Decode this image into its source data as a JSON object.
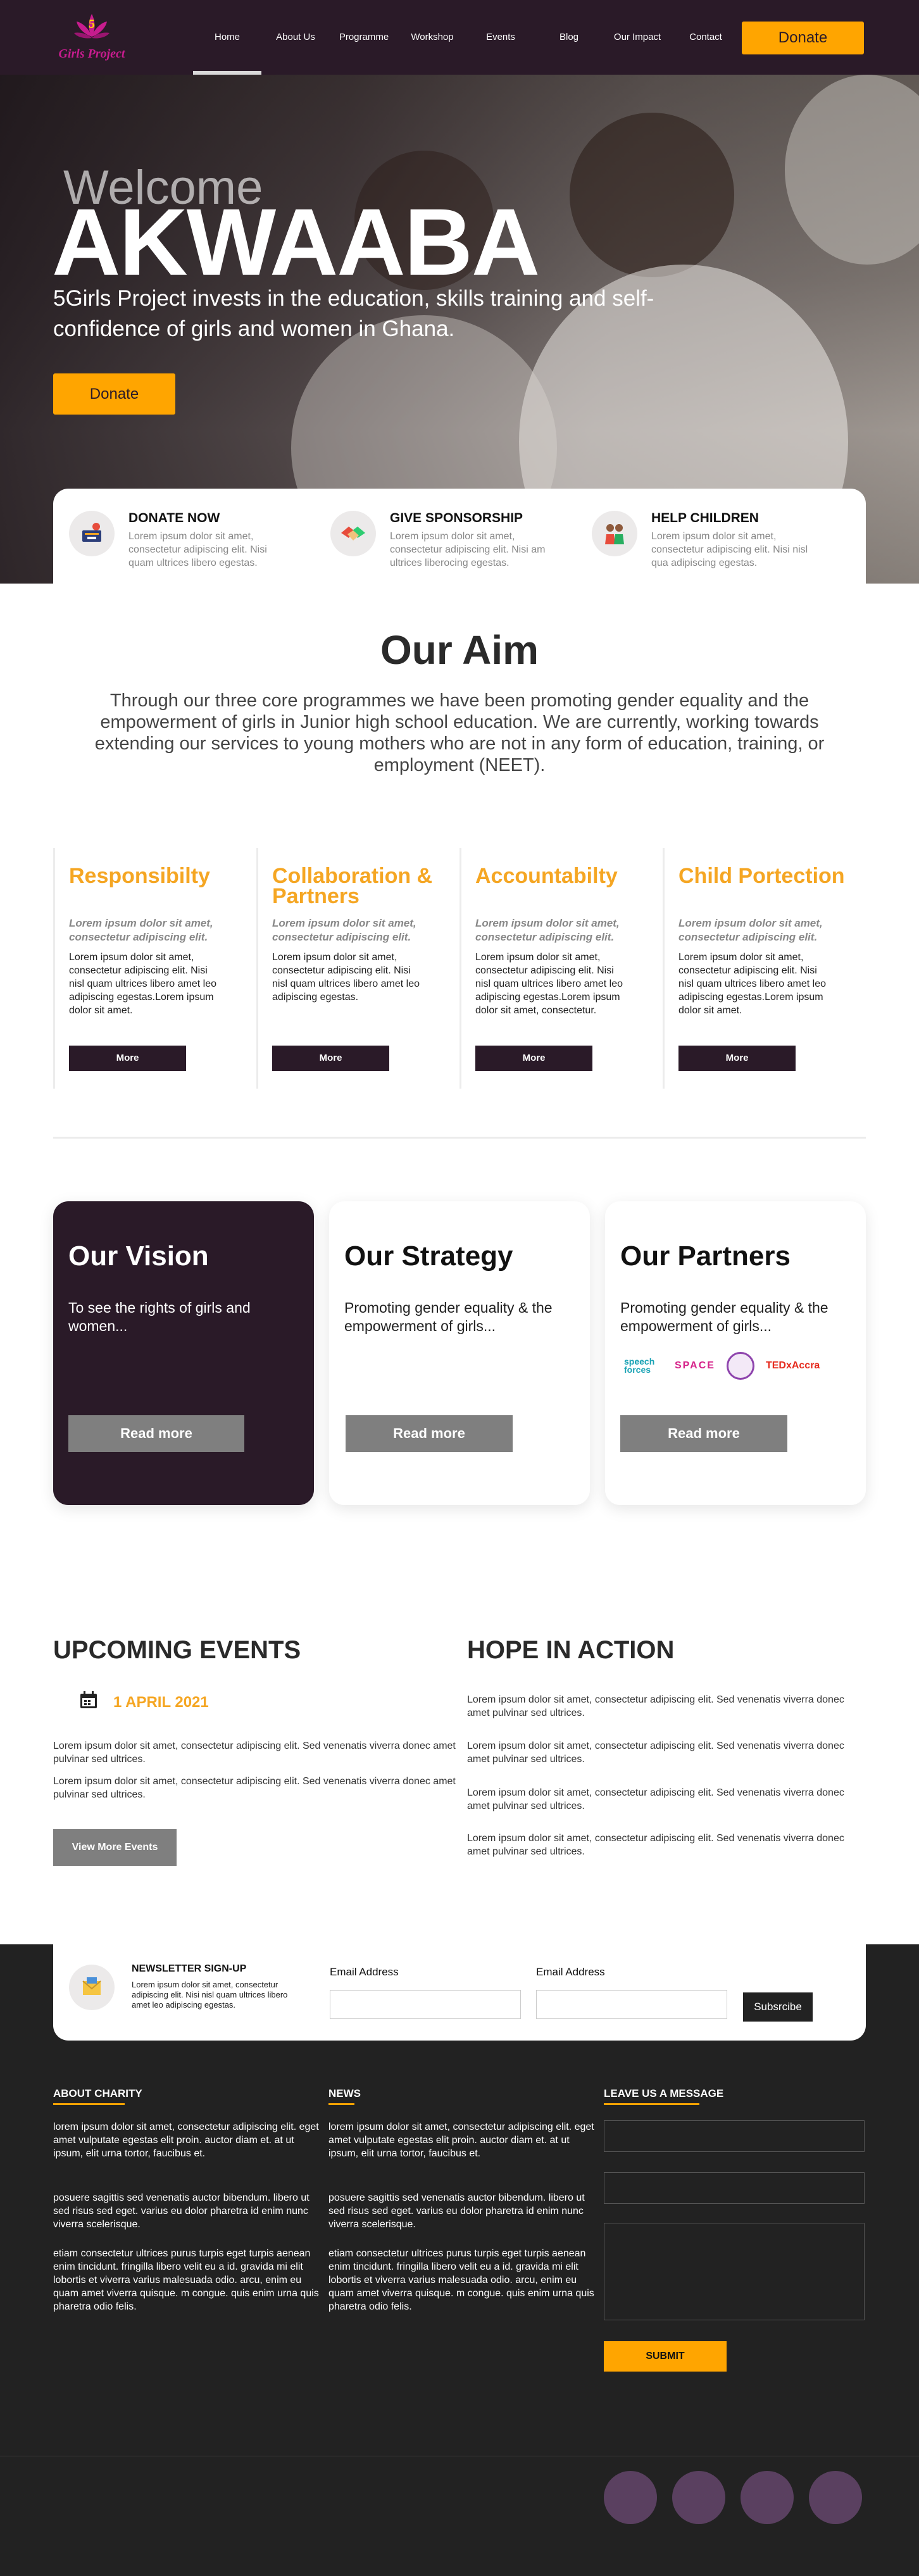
{
  "nav": {
    "logo_text": "Girls Project",
    "links": [
      "Home",
      "About Us",
      "Programme",
      "Workshop",
      "Events",
      "Blog",
      "Our Impact",
      "Contact"
    ],
    "donate_label": "Donate"
  },
  "hero": {
    "welcome": "Welcome",
    "title": "AKWAABA",
    "subtitle": "5Girls Project invests in the education, skills training and self-confidence of girls and women in Ghana.",
    "donate_label": "Donate"
  },
  "services": [
    {
      "title": "DONATE NOW",
      "text": "Lorem ipsum dolor sit amet, consectetur adipiscing elit. Nisi quam ultrices libero egestas.",
      "icon": "donate-icon"
    },
    {
      "title": "GIVE SPONSORSHIP",
      "text": "Lorem ipsum dolor sit amet, consectetur adipiscing elit. Nisi am ultrices liberocing egestas.",
      "icon": "handshake-icon"
    },
    {
      "title": "HELP CHILDREN",
      "text": "Lorem ipsum dolor sit amet, consectetur adipiscing elit. Nisi nisl qua adipiscing egestas.",
      "icon": "children-icon"
    }
  ],
  "aim": {
    "title": "Our Aim",
    "text": "Through our three core programmes we have been promoting gender equality and the empowerment of girls in Junior high school education. We are currently, working towards extending our services to young mothers who are not in any form of education, training, or employment (NEET)."
  },
  "values": [
    {
      "title": "Responsibilty",
      "lead": "Lorem ipsum dolor sit amet, consectetur adipiscing elit.",
      "body": "Lorem ipsum dolor sit amet, consectetur adipiscing elit. Nisi nisl quam ultrices libero amet leo adipiscing egestas.Lorem ipsum dolor sit amet.",
      "more": "More"
    },
    {
      "title": "Collaboration & Partners",
      "lead": "Lorem ipsum dolor sit amet, consectetur adipiscing elit.",
      "body": "Lorem ipsum dolor sit amet, consectetur adipiscing elit. Nisi nisl quam ultrices libero amet leo adipiscing egestas.",
      "more": "More"
    },
    {
      "title": "Accountabilty",
      "lead": "Lorem ipsum dolor sit amet, consectetur adipiscing elit.",
      "body": "Lorem ipsum dolor sit amet, consectetur adipiscing elit. Nisi nisl quam ultrices libero amet leo adipiscing egestas.Lorem ipsum dolor sit amet, consectetur.",
      "more": "More"
    },
    {
      "title": "Child Portection",
      "lead": "Lorem ipsum dolor sit amet, consectetur adipiscing elit.",
      "body": "Lorem ipsum dolor sit amet, consectetur adipiscing elit. Nisi nisl quam ultrices libero amet leo adipiscing egestas.Lorem ipsum dolor sit amet.",
      "more": "More"
    }
  ],
  "cards": [
    {
      "title": "Our Vision",
      "text": "To see the rights of girls and women...",
      "button": "Read more"
    },
    {
      "title": "Our Strategy",
      "text": "Promoting gender equality & the empowerment of girls...",
      "button": "Read more"
    },
    {
      "title": "Our Partners",
      "text": "Promoting gender equality & the empowerment of girls...",
      "button": "Read more"
    }
  ],
  "partners": [
    "speech forces",
    "SPACE",
    "TEDxAccra"
  ],
  "events": {
    "title": "UPCOMING EVENTS",
    "date": "1 APRIL 2021",
    "paragraphs": [
      "Lorem ipsum dolor sit amet, consectetur adipiscing elit. Sed venenatis viverra donec amet pulvinar sed ultrices.",
      "Lorem ipsum dolor sit amet, consectetur adipiscing elit. Sed venenatis viverra donec amet pulvinar sed ultrices."
    ],
    "view_more": "View More Events"
  },
  "hope": {
    "title": "HOPE IN ACTION",
    "paragraphs": [
      "Lorem ipsum dolor sit amet, consectetur adipiscing elit. Sed venenatis viverra donec amet pulvinar sed ultrices.",
      "Lorem ipsum dolor sit amet, consectetur adipiscing elit. Sed venenatis viverra donec amet pulvinar sed ultrices.",
      "Lorem ipsum dolor sit amet, consectetur adipiscing elit. Sed venenatis viverra donec amet pulvinar sed ultrices.",
      "Lorem ipsum dolor sit amet, consectetur adipiscing elit. Sed venenatis viverra donec amet pulvinar sed ultrices."
    ]
  },
  "newsletter": {
    "title": "NEWSLETTER SIGN-UP",
    "text": "Lorem ipsum dolor sit amet, consectetur adipiscing elit. Nisi nisl quam ultrices libero amet leo adipiscing egestas.",
    "label1": "Email Address",
    "label2": "Email Address",
    "button": "Subsrcibe"
  },
  "footer": {
    "about": {
      "title": "ABOUT CHARITY",
      "paragraphs": [
        "lorem ipsum dolor sit amet, consectetur adipiscing elit. eget amet vulputate egestas elit proin. auctor diam et. at ut ipsum, elit urna tortor, faucibus et.",
        "posuere sagittis sed venenatis auctor bibendum. libero ut sed risus sed eget. varius eu dolor pharetra id enim nunc viverra scelerisque.",
        "etiam consectetur ultrices purus turpis eget turpis aenean enim tincidunt. fringilla libero velit eu a id. gravida mi elit lobortis et viverra varius malesuada odio. arcu, enim eu quam amet viverra quisque. m congue. quis enim urna quis pharetra odio felis."
      ]
    },
    "news": {
      "title": "NEWS",
      "paragraphs": [
        "lorem ipsum dolor sit amet, consectetur adipiscing elit. eget amet vulputate egestas elit proin. auctor diam et. at ut ipsum, elit urna tortor, faucibus et.",
        "posuere sagittis sed venenatis auctor bibendum. libero ut sed risus sed eget. varius eu dolor pharetra id enim nunc viverra scelerisque.",
        "etiam consectetur ultrices purus turpis eget turpis aenean enim tincidunt. fringilla libero velit eu a id. gravida mi elit lobortis et viverra varius malesuada odio. arcu, enim eu quam amet viverra quisque. m congue. quis enim urna quis pharetra odio felis."
      ]
    },
    "message": {
      "title": "LEAVE US A MESSAGE",
      "submit": "SUBMIT"
    }
  },
  "colors": {
    "brand_dark": "#2a1a28",
    "accent": "#ffa500",
    "value_title": "#f5a623",
    "footer_bg": "#222222",
    "social": "#5a4060"
  }
}
